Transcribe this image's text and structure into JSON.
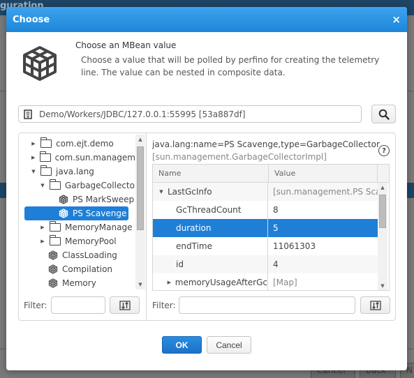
{
  "background": {
    "title_fragment": "guration",
    "buttons": [
      "Cancel",
      "Back",
      "N"
    ]
  },
  "dialog": {
    "title": "Choose",
    "close_label": "×",
    "intro": {
      "icon": "mbean-cube-icon",
      "title": "Choose an MBean value",
      "description": "Choose a value that will be polled by perfino for creating the telemetry line. The value can be nested in composite data."
    },
    "connection": {
      "icon": "server-icon",
      "value": "Demo/Workers/JDBC/127.0.0.1:55995 [53a887df]",
      "search_icon": "search-icon"
    },
    "tree": {
      "items": [
        {
          "label": "com.ejt.demo",
          "level": 0,
          "type": "folder",
          "expander": "collapsed"
        },
        {
          "label": "com.sun.managem",
          "level": 0,
          "type": "folder",
          "expander": "collapsed"
        },
        {
          "label": "java.lang",
          "level": 0,
          "type": "folder",
          "expander": "expanded"
        },
        {
          "label": "GarbageCollecto",
          "level": 1,
          "type": "folder",
          "expander": "expanded"
        },
        {
          "label": "PS MarkSweep",
          "level": 2,
          "type": "bean",
          "expander": "none"
        },
        {
          "label": "PS Scavenge",
          "level": 2,
          "type": "bean",
          "expander": "none",
          "selected": true
        },
        {
          "label": "MemoryManage",
          "level": 1,
          "type": "folder",
          "expander": "collapsed"
        },
        {
          "label": "MemoryPool",
          "level": 1,
          "type": "folder",
          "expander": "collapsed"
        },
        {
          "label": "ClassLoading",
          "level": 1,
          "type": "bean",
          "expander": "none"
        },
        {
          "label": "Compilation",
          "level": 1,
          "type": "bean",
          "expander": "none"
        },
        {
          "label": "Memory",
          "level": 1,
          "type": "bean",
          "expander": "none"
        }
      ],
      "filter_label": "Filter:",
      "filter_value": ""
    },
    "detail": {
      "object_name": "java.lang:name=PS Scavenge,type=GarbageCollector",
      "object_class": "[sun.management.GarbageCollectorImpl]",
      "help_label": "?",
      "columns": [
        "Name",
        "Value"
      ],
      "rows": [
        {
          "name": "LastGcInfo",
          "value": "[sun.management.PS Scav",
          "level": 0,
          "expander": "expanded",
          "muted": true
        },
        {
          "name": "GcThreadCount",
          "value": "8",
          "level": 1,
          "expander": "none"
        },
        {
          "name": "duration",
          "value": "5",
          "level": 1,
          "expander": "none",
          "selected": true
        },
        {
          "name": "endTime",
          "value": "11061303",
          "level": 1,
          "expander": "none"
        },
        {
          "name": "id",
          "value": "4",
          "level": 1,
          "expander": "none"
        },
        {
          "name": "memoryUsageAfterGc",
          "value": "[Map]",
          "level": 1,
          "expander": "collapsed",
          "muted": true
        }
      ],
      "filter_label": "Filter:",
      "filter_value": ""
    },
    "buttons": {
      "ok": "OK",
      "cancel": "Cancel"
    }
  },
  "colors": {
    "header_blue": "#2591e2",
    "selection_blue": "#1f7fd6",
    "background_dim": "#7a7a7a"
  }
}
